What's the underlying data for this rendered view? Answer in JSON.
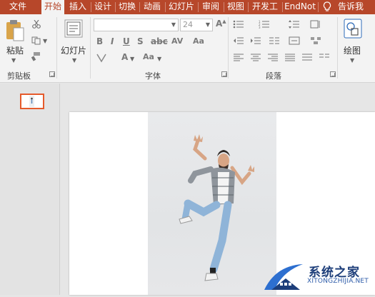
{
  "tabs": [
    {
      "label": "文件",
      "active": false
    },
    {
      "label": "开始",
      "active": true
    },
    {
      "label": "插入",
      "active": false
    },
    {
      "label": "设计",
      "active": false
    },
    {
      "label": "切换",
      "active": false
    },
    {
      "label": "动画",
      "active": false
    },
    {
      "label": "幻灯片",
      "active": false
    },
    {
      "label": "审阅",
      "active": false
    },
    {
      "label": "视图",
      "active": false
    },
    {
      "label": "开发工",
      "active": false
    },
    {
      "label": "EndNot",
      "active": false
    },
    {
      "label": "告诉我",
      "active": false
    }
  ],
  "ribbon": {
    "clipboard": {
      "paste_label": "粘贴",
      "group_label": "剪贴板"
    },
    "slides": {
      "new_slide_label": "幻灯片"
    },
    "font": {
      "group_label": "字体",
      "font_name": "",
      "font_size": "24"
    },
    "paragraph": {
      "group_label": "段落"
    },
    "drawing": {
      "draw_label": "绘图"
    }
  },
  "slide_panel": {
    "slide_count": 1
  },
  "watermark": {
    "text": "系统之家",
    "url": "XITONGZHIJIA.NET"
  },
  "colors": {
    "accent": "#b7472a",
    "thumb_border": "#e55a2b"
  }
}
